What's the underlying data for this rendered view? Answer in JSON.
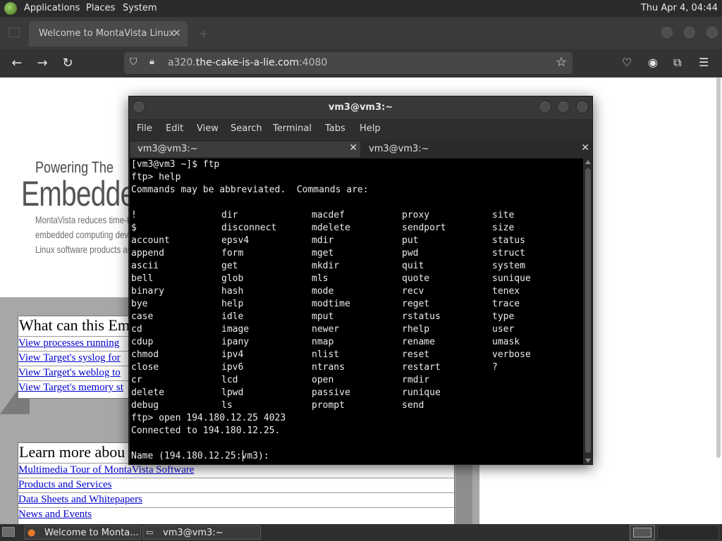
{
  "top_panel": {
    "menus": [
      "Applications",
      "Places",
      "System"
    ],
    "clock": "Thu Apr 4, 04:44"
  },
  "browser": {
    "tab_title": "Welcome to MontaVista Linux",
    "tab_close": "✕",
    "new_tab": "+",
    "url_host_prefix": "a320.",
    "url_domain": "the-cake-is-a-lie.com",
    "url_port": ":4080",
    "icons": [
      "back-icon",
      "forward-icon",
      "reload-icon",
      "shield-icon",
      "lock-icon",
      "bookmark-star-icon",
      "pocket-icon",
      "account-icon",
      "extensions-icon",
      "menu-icon"
    ]
  },
  "page": {
    "heading_small": "Powering The",
    "heading_large": "Embedded",
    "tagline": [
      "MontaVista reduces time-to",
      "embedded computing deve",
      "Linux software products an"
    ],
    "box1": {
      "heading": "What can this Em",
      "links": [
        "View processes running",
        "View Target's syslog for",
        "View Target's weblog to",
        "View Target's memory st"
      ]
    },
    "box2": {
      "heading": "Learn more abou",
      "links": [
        "Multimedia Tour of MontaVista Software",
        "Products and Services",
        "Data Sheets and Whitepapers",
        "News and Events"
      ]
    }
  },
  "terminal": {
    "title": "vm3@vm3:~",
    "menu": [
      "File",
      "Edit",
      "View",
      "Search",
      "Terminal",
      "Tabs",
      "Help"
    ],
    "tabs": [
      "vm3@vm3:~",
      "vm3@vm3:~"
    ],
    "tab_close": "✕",
    "lines_before": [
      "[vm3@vm3 ~]$ ftp",
      "ftp> help",
      "Commands may be abbreviated.  Commands are:",
      ""
    ],
    "command_rows": [
      [
        "!",
        "dir",
        "macdef",
        "proxy",
        "site"
      ],
      [
        "$",
        "disconnect",
        "mdelete",
        "sendport",
        "size"
      ],
      [
        "account",
        "epsv4",
        "mdir",
        "put",
        "status"
      ],
      [
        "append",
        "form",
        "mget",
        "pwd",
        "struct"
      ],
      [
        "ascii",
        "get",
        "mkdir",
        "quit",
        "system"
      ],
      [
        "bell",
        "glob",
        "mls",
        "quote",
        "sunique"
      ],
      [
        "binary",
        "hash",
        "mode",
        "recv",
        "tenex"
      ],
      [
        "bye",
        "help",
        "modtime",
        "reget",
        "trace"
      ],
      [
        "case",
        "idle",
        "mput",
        "rstatus",
        "type"
      ],
      [
        "cd",
        "image",
        "newer",
        "rhelp",
        "user"
      ],
      [
        "cdup",
        "ipany",
        "nmap",
        "rename",
        "umask"
      ],
      [
        "chmod",
        "ipv4",
        "nlist",
        "reset",
        "verbose"
      ],
      [
        "close",
        "ipv6",
        "ntrans",
        "restart",
        "?"
      ],
      [
        "cr",
        "lcd",
        "open",
        "rmdir",
        ""
      ],
      [
        "delete",
        "lpwd",
        "passive",
        "runique",
        ""
      ],
      [
        "debug",
        "ls",
        "prompt",
        "send",
        ""
      ]
    ],
    "lines_after": [
      "ftp> open 194.180.12.25 4023",
      "Connected to 194.180.12.25.",
      "",
      "Name (194.180.12.25:vm3):"
    ]
  },
  "taskbar": {
    "tasks": [
      "Welcome to Monta...",
      "vm3@vm3:~"
    ]
  }
}
